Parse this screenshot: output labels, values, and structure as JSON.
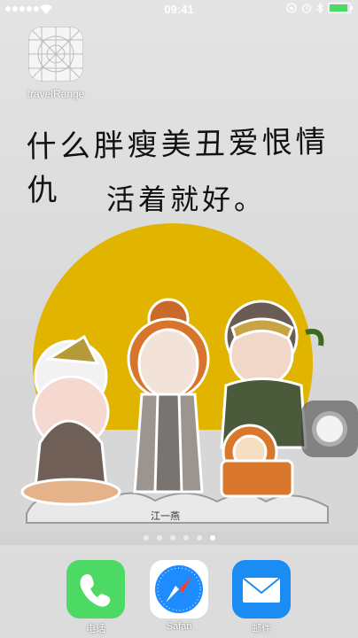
{
  "status_bar": {
    "time": "09:41",
    "signal_dots": 5,
    "battery_color": "#4cd964"
  },
  "home_icons": [
    {
      "label": "travelRange",
      "icon": "grid-placeholder-icon"
    }
  ],
  "wallpaper": {
    "line1": "什么胖瘦美丑爱恨情仇",
    "line2": "活着就好。",
    "signature": "江一燕",
    "sun_color": "#e1b400"
  },
  "page_dots": {
    "count": 6,
    "active_index": 5
  },
  "dock": [
    {
      "label": "电话",
      "icon": "phone-icon",
      "color": "#4cd964"
    },
    {
      "label": "Safari",
      "icon": "safari-compass-icon",
      "color": "#1e8bff"
    },
    {
      "label": "邮件",
      "icon": "mail-icon",
      "color": "#1a8cf2"
    }
  ]
}
